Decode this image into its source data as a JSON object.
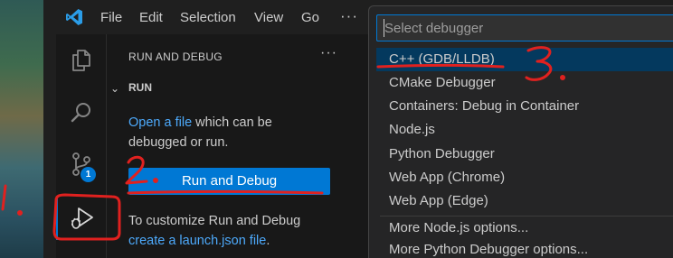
{
  "menu": {
    "items": [
      "File",
      "Edit",
      "Selection",
      "View",
      "Go"
    ],
    "more": "···"
  },
  "activity_bar": {
    "icons": [
      "explorer-icon",
      "search-icon",
      "source-control-icon",
      "run-debug-icon"
    ],
    "source_control_badge": "1"
  },
  "sidebar": {
    "title": "RUN AND DEBUG",
    "more": "···",
    "section_label": "RUN",
    "open_file_link": "Open a file",
    "open_file_text_1": " which can be",
    "open_file_text_2": "debugged or run.",
    "run_button_label": "Run and Debug",
    "customize_text": "To customize Run and Debug",
    "launch_link": "create a launch.json file",
    "launch_suffix": "."
  },
  "quick_pick": {
    "placeholder": "Select debugger",
    "items": [
      "C++ (GDB/LLDB)",
      "CMake Debugger",
      "Containers: Debug in Container",
      "Node.js",
      "Python Debugger",
      "Web App (Chrome)",
      "Web App (Edge)",
      "More Node.js options...",
      "More Python Debugger options..."
    ]
  },
  "annotations": {
    "step1": "1.",
    "step2": "2.",
    "step3": "3.",
    "color": "#e0211f"
  },
  "colors": {
    "accent": "#0078d4",
    "link": "#4daafc",
    "selection": "#04395e"
  }
}
